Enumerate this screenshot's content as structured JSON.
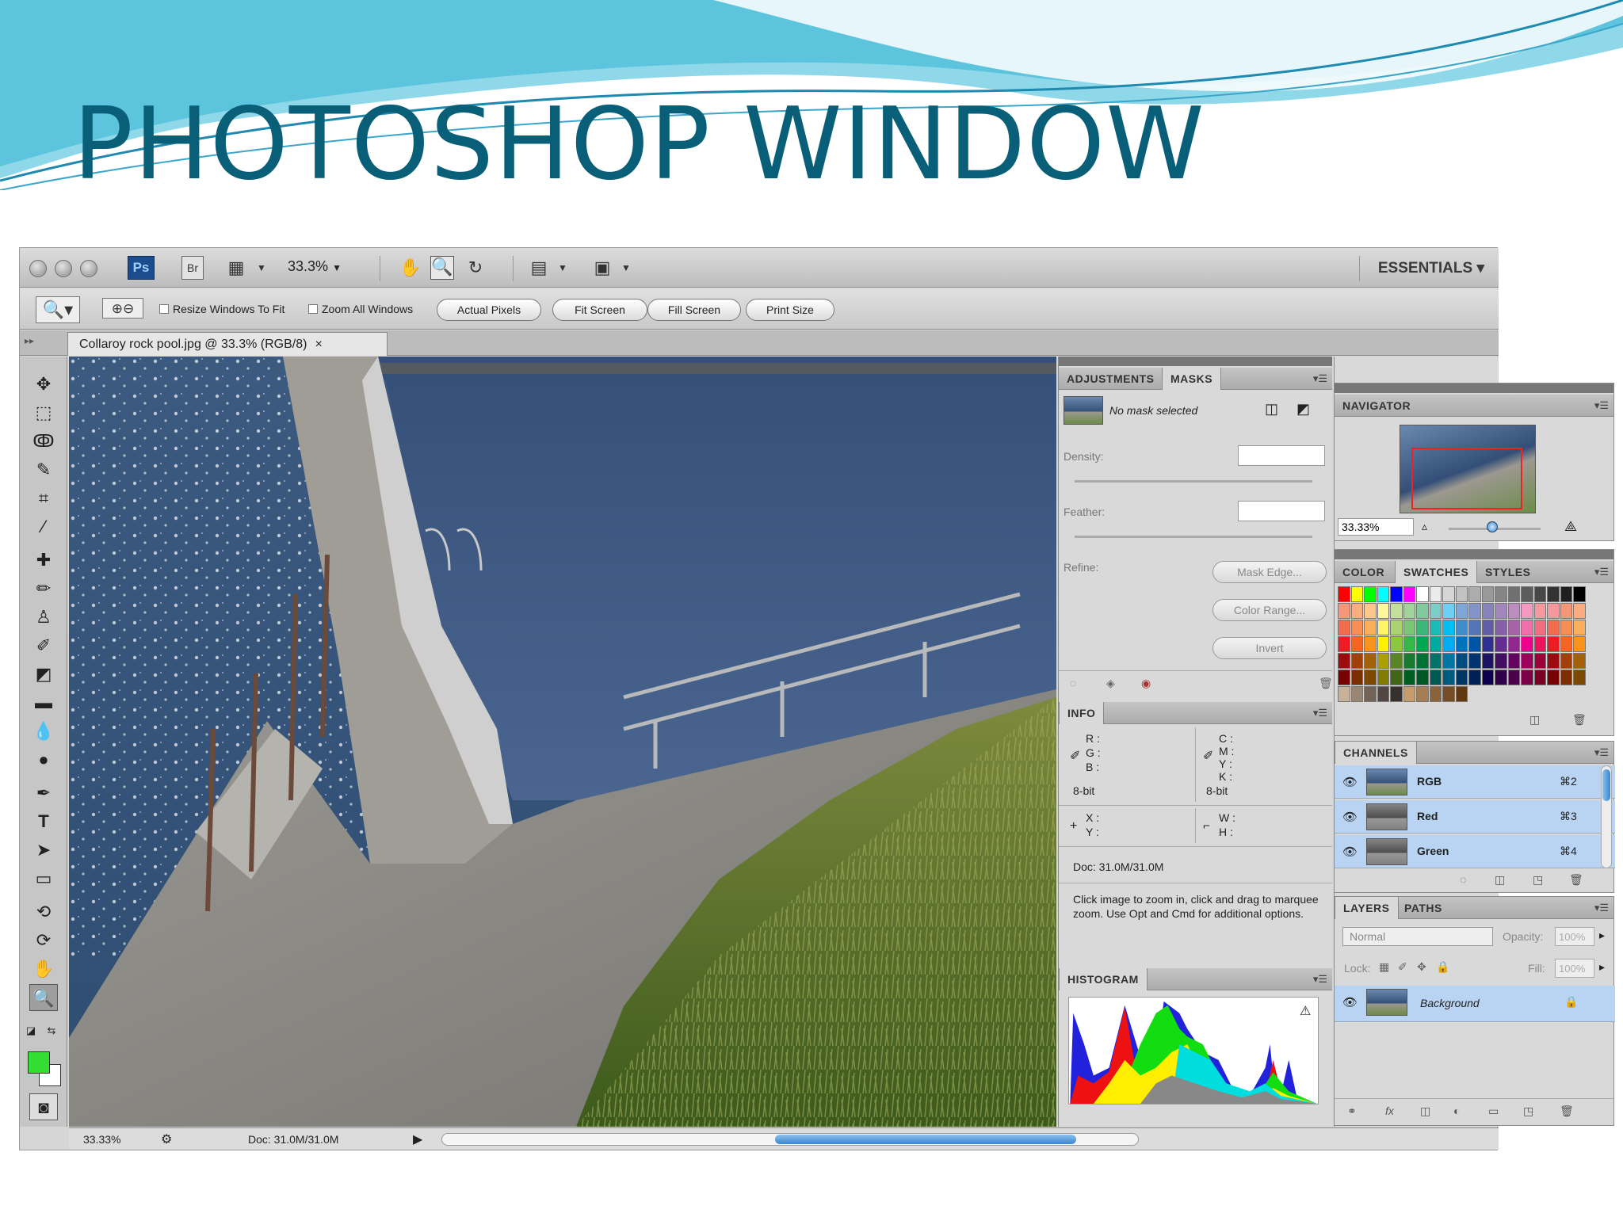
{
  "slide": {
    "title": "PHOTOSHOP WINDOW",
    "title_color": "#0a5f78",
    "wave_colors": [
      "#5cc4dd",
      "#8fd8ea",
      "#1e8ab0"
    ]
  },
  "app_bar": {
    "ps_label": "Ps",
    "br_label": "Br",
    "zoom": "33.3%",
    "workspace": "ESSENTIALS ▾",
    "icons": [
      "launch-bridge-icon",
      "view-extras-icon",
      "hand-tool-icon",
      "zoom-tool-icon",
      "rotate-view-icon",
      "arrange-documents-icon",
      "screen-mode-icon"
    ]
  },
  "options_bar": {
    "resize_windows": "Resize Windows To Fit",
    "zoom_all": "Zoom All Windows",
    "actual_pixels": "Actual Pixels",
    "fit_screen": "Fit Screen",
    "fill_screen": "Fill Screen",
    "print_size": "Print Size"
  },
  "document": {
    "tab_title": "Collaroy rock pool.jpg @ 33.3% (RGB/8)",
    "close": "×"
  },
  "status_bar": {
    "zoom": "33.33%",
    "doc": "Doc: 31.0M/31.0M"
  },
  "adjustments_panel": {
    "tabs": [
      "ADJUSTMENTS",
      "MASKS"
    ],
    "mask_status": "No mask selected",
    "density": "Density:",
    "feather": "Feather:",
    "refine": "Refine:",
    "buttons": [
      "Mask Edge...",
      "Color Range...",
      "Invert"
    ]
  },
  "info_panel": {
    "tab": "INFO",
    "rgb_labels": [
      "R :",
      "G :",
      "B :"
    ],
    "cmyk_labels": [
      "C :",
      "M :",
      "Y :",
      "K :"
    ],
    "bit_left": "8-bit",
    "bit_right": "8-bit",
    "xy_labels": [
      "X :",
      "Y :"
    ],
    "wh_labels": [
      "W :",
      "H :"
    ],
    "doc": "Doc: 31.0M/31.0M",
    "hint": "Click image to zoom in, click and drag to marquee zoom.  Use Opt and Cmd for additional options."
  },
  "histogram_panel": {
    "tab": "HISTOGRAM",
    "warning": "⚠"
  },
  "navigator_panel": {
    "tab": "NAVIGATOR",
    "zoom": "33.33%"
  },
  "swatches_panel": {
    "tabs": [
      "COLOR",
      "SWATCHES",
      "STYLES"
    ],
    "swatches": [
      [
        "#ff0000",
        "#ffff00",
        "#00ff00",
        "#00ffff",
        "#0000ff",
        "#ff00ff",
        "#ffffff",
        "#ebebeb",
        "#d6d6d6",
        "#c2c2c2",
        "#adadad",
        "#999999",
        "#858585",
        "#707070",
        "#5c5c5c",
        "#474747",
        "#333333",
        "#1f1f1f",
        "#000000"
      ],
      [
        "#f7977a",
        "#f9ad81",
        "#fdc68a",
        "#fff79a",
        "#c4df9b",
        "#a3d39c",
        "#82ca9d",
        "#7bcdc8",
        "#6ecff6",
        "#7ea7d8",
        "#8493ca",
        "#8882be",
        "#a187be",
        "#bc8dbf",
        "#f49ac2",
        "#f6989d",
        "#f5989d",
        "#f69679",
        "#f9ad81"
      ],
      [
        "#f26c4f",
        "#f68e55",
        "#fbaf5c",
        "#fff467",
        "#acd372",
        "#7cc576",
        "#3bb878",
        "#1abbb4",
        "#00bff3",
        "#438ccb",
        "#5574b9",
        "#605ca8",
        "#855fa8",
        "#a763a8",
        "#f06ea9",
        "#f26d7d",
        "#f26c4f",
        "#f68e55",
        "#fbaf5c"
      ],
      [
        "#ed1c24",
        "#f26522",
        "#f7941d",
        "#fff200",
        "#8dc63f",
        "#39b54a",
        "#00a651",
        "#00a99d",
        "#00aeef",
        "#0072bc",
        "#0054a6",
        "#2e3192",
        "#662d91",
        "#92278f",
        "#ec008c",
        "#ed145b",
        "#ed1c24",
        "#f26522",
        "#f7941d"
      ],
      [
        "#9e0b0f",
        "#a0410d",
        "#a36209",
        "#aba000",
        "#598527",
        "#1a7b30",
        "#007236",
        "#00746b",
        "#0076a3",
        "#004b80",
        "#003471",
        "#1b1464",
        "#440e62",
        "#630460",
        "#9e005d",
        "#9e0039",
        "#9e0b0f",
        "#a0410d",
        "#a36209"
      ],
      [
        "#790000",
        "#7b2e00",
        "#7d4900",
        "#827b00",
        "#406618",
        "#005e20",
        "#005826",
        "#005952",
        "#005b7f",
        "#003663",
        "#002157",
        "#0d004c",
        "#32004b",
        "#4b0049",
        "#7b0046",
        "#7a0026",
        "#790000",
        "#7b2e00",
        "#7d4900"
      ],
      [
        "#c7b299",
        "#998675",
        "#736357",
        "#534741",
        "#37302d",
        "#c69c6d",
        "#a67c52",
        "#8c6239",
        "#754c24",
        "#603913"
      ]
    ]
  },
  "channels_panel": {
    "tab": "CHANNELS",
    "rows": [
      {
        "name": "RGB",
        "shortcut": "⌘2"
      },
      {
        "name": "Red",
        "shortcut": "⌘3"
      },
      {
        "name": "Green",
        "shortcut": "⌘4"
      }
    ]
  },
  "layers_panel": {
    "tabs": [
      "LAYERS",
      "PATHS"
    ],
    "blend": "Normal",
    "opacity_label": "Opacity:",
    "opacity": "100%",
    "lock_label": "Lock:",
    "fill_label": "Fill:",
    "fill": "100%",
    "layer_name": "Background"
  }
}
